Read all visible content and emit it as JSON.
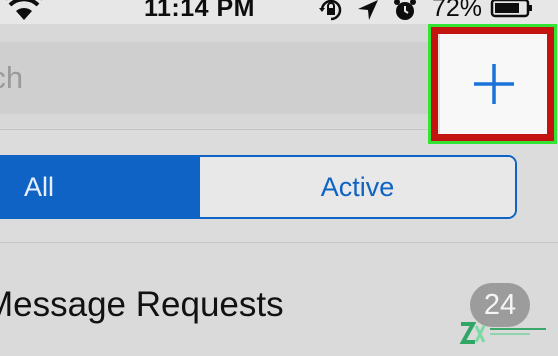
{
  "status_bar": {
    "time": "11:14 PM",
    "battery_percent": "72%",
    "icons": [
      "wifi-icon",
      "orientation-lock-icon",
      "location-icon",
      "alarm-icon",
      "battery-icon"
    ]
  },
  "search": {
    "placeholder_fragment": "rch"
  },
  "compose": {
    "icon": "plus-icon",
    "accent": "#1a73d9",
    "highlight_border": "#33e433",
    "highlight_fill": "#c4140f"
  },
  "filter_tabs": {
    "all_label": "All",
    "active_label": "Active",
    "selected": "All",
    "accent": "#0e63c4"
  },
  "requests": {
    "label": "Message Requests",
    "count": "24"
  },
  "watermark": {
    "icon": "watermark-logo"
  }
}
